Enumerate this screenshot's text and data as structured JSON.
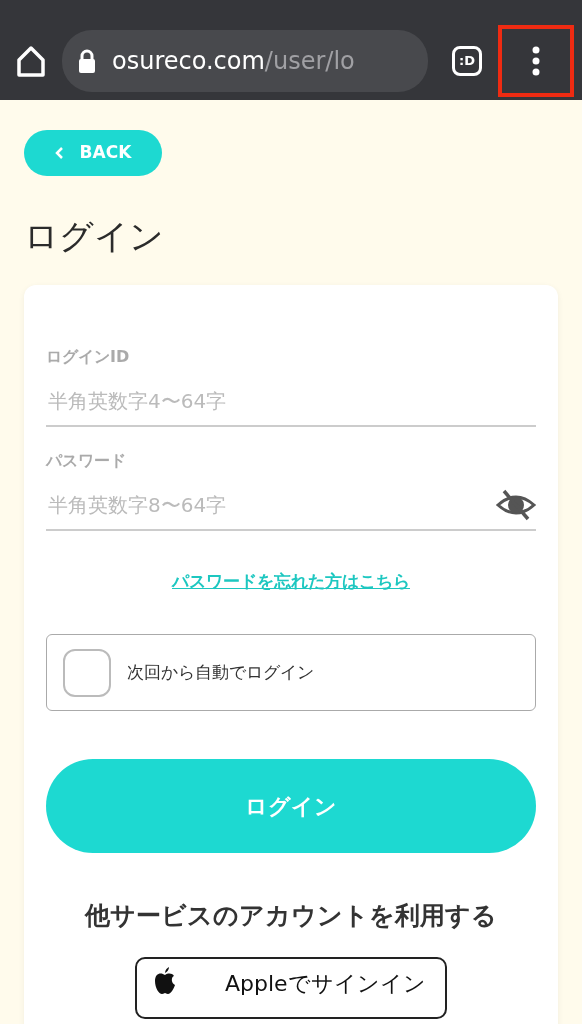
{
  "browser": {
    "url_host": "osureco.com",
    "url_path": "/user/lo",
    "tab_badge": ":D",
    "menu_highlighted": true
  },
  "back_button": "BACK",
  "title": "ログイン",
  "fields": [
    {
      "label": "ログインID",
      "placeholder": "半角英数字4〜64字",
      "kind": "text"
    },
    {
      "label": "パスワード",
      "placeholder": "半角英数字8〜64字",
      "kind": "password"
    }
  ],
  "forgot_link": "パスワードを忘れた方はこちら",
  "auto_login": {
    "label": "次回から自動でログイン",
    "checked": false
  },
  "login_button": "ログイン",
  "other_services": {
    "heading": "他サービスのアカウントを利用する",
    "apple_button": "Appleでサインイン"
  }
}
